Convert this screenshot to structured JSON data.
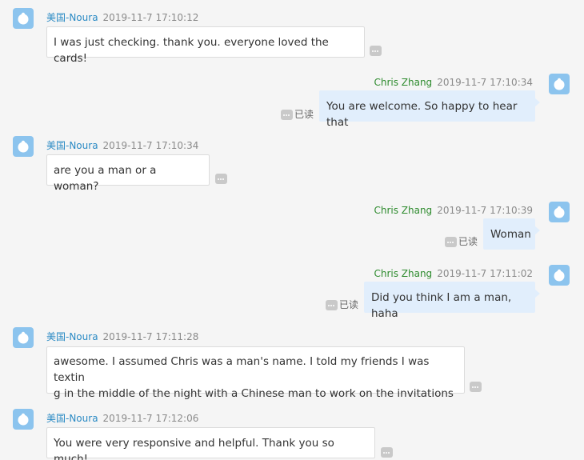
{
  "participants": {
    "other": "美国-Noura",
    "me": "Chris Zhang"
  },
  "read_label": "已读",
  "messages": [
    {
      "sender": "美国-Noura",
      "time": "2019-11-7 17:10:12",
      "text": "I was just checking. thank you. everyone loved the cards!"
    },
    {
      "sender": "Chris Zhang",
      "time": "2019-11-7 17:10:34",
      "text": "You are welcome. So happy to hear that"
    },
    {
      "sender": "美国-Noura",
      "time": "2019-11-7 17:10:34",
      "text": "are you a man or a woman?"
    },
    {
      "sender": "Chris Zhang",
      "time": "2019-11-7 17:10:39",
      "text": "Woman"
    },
    {
      "sender": "Chris Zhang",
      "time": "2019-11-7 17:11:02",
      "text": "Did you think I am a man, haha"
    },
    {
      "sender": "美国-Noura",
      "time": "2019-11-7 17:11:28",
      "text_lines": [
        "awesome. I assumed Chris was a man's name. I told my friends I was textin",
        "g in the middle of the night with a Chinese man to work on the invitations"
      ]
    },
    {
      "sender": "美国-Noura",
      "time": "2019-11-7 17:12:06",
      "text": "You were very responsive and helpful. Thank you so much!"
    }
  ]
}
